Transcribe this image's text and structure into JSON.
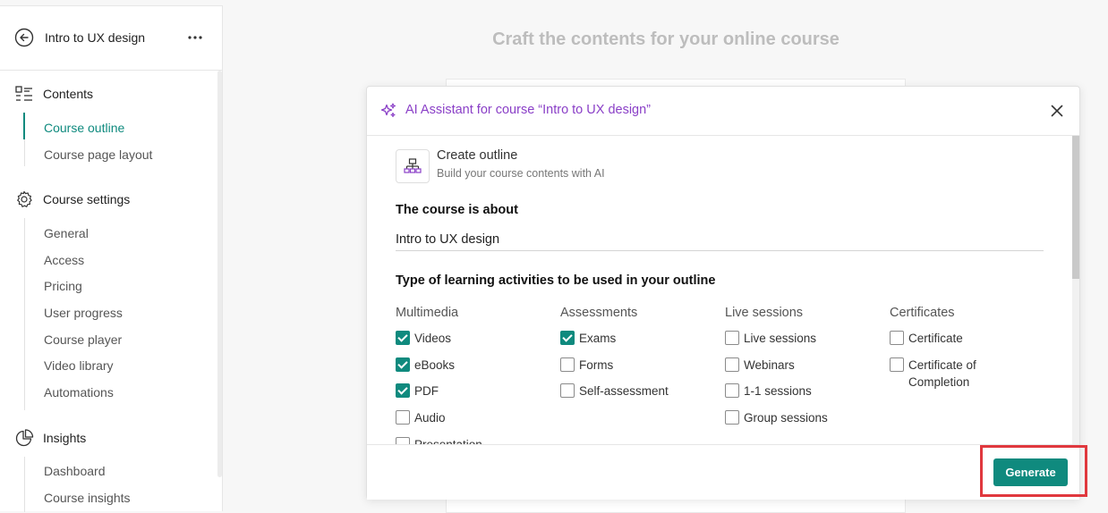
{
  "sidebar": {
    "course_title": "Intro to UX design",
    "sections": [
      {
        "label": "Contents",
        "icon": "contents-list-icon",
        "items": [
          {
            "label": "Course outline",
            "active": true
          },
          {
            "label": "Course page layout"
          }
        ]
      },
      {
        "label": "Course settings",
        "icon": "gear-icon",
        "items": [
          {
            "label": "General"
          },
          {
            "label": "Access"
          },
          {
            "label": "Pricing"
          },
          {
            "label": "User progress"
          },
          {
            "label": "Course player"
          },
          {
            "label": "Video library"
          },
          {
            "label": "Automations"
          }
        ]
      },
      {
        "label": "Insights",
        "icon": "pie-chart-icon",
        "items": [
          {
            "label": "Dashboard"
          },
          {
            "label": "Course insights"
          }
        ]
      }
    ]
  },
  "main": {
    "heading": "Craft the contents for your online course"
  },
  "modal": {
    "title": "AI Assistant for course “Intro to UX design”",
    "create": {
      "title": "Create outline",
      "subtitle": "Build your course contents with AI"
    },
    "about_label": "The course is about",
    "about_value": "Intro to UX design",
    "activities_label": "Type of learning activities to be used in your outline",
    "columns": [
      {
        "heading": "Multimedia",
        "options": [
          {
            "label": "Videos",
            "checked": true
          },
          {
            "label": "eBooks",
            "checked": true
          },
          {
            "label": "PDF",
            "checked": true
          },
          {
            "label": "Audio",
            "checked": false
          },
          {
            "label": "Presentation",
            "checked": false
          }
        ]
      },
      {
        "heading": "Assessments",
        "options": [
          {
            "label": "Exams",
            "checked": true
          },
          {
            "label": "Forms",
            "checked": false
          },
          {
            "label": "Self-assessment",
            "checked": false
          }
        ]
      },
      {
        "heading": "Live sessions",
        "options": [
          {
            "label": "Live sessions",
            "checked": false
          },
          {
            "label": "Webinars",
            "checked": false
          },
          {
            "label": "1-1 sessions",
            "checked": false
          },
          {
            "label": "Group sessions",
            "checked": false
          }
        ]
      },
      {
        "heading": "Certificates",
        "options": [
          {
            "label": "Certificate",
            "checked": false
          },
          {
            "label": "Certificate of Completion",
            "checked": false
          }
        ]
      }
    ],
    "generate_label": "Generate"
  },
  "colors": {
    "accent": "#0f8a7e",
    "ai_purple": "#8a3fc7",
    "highlight": "#e0383e"
  }
}
